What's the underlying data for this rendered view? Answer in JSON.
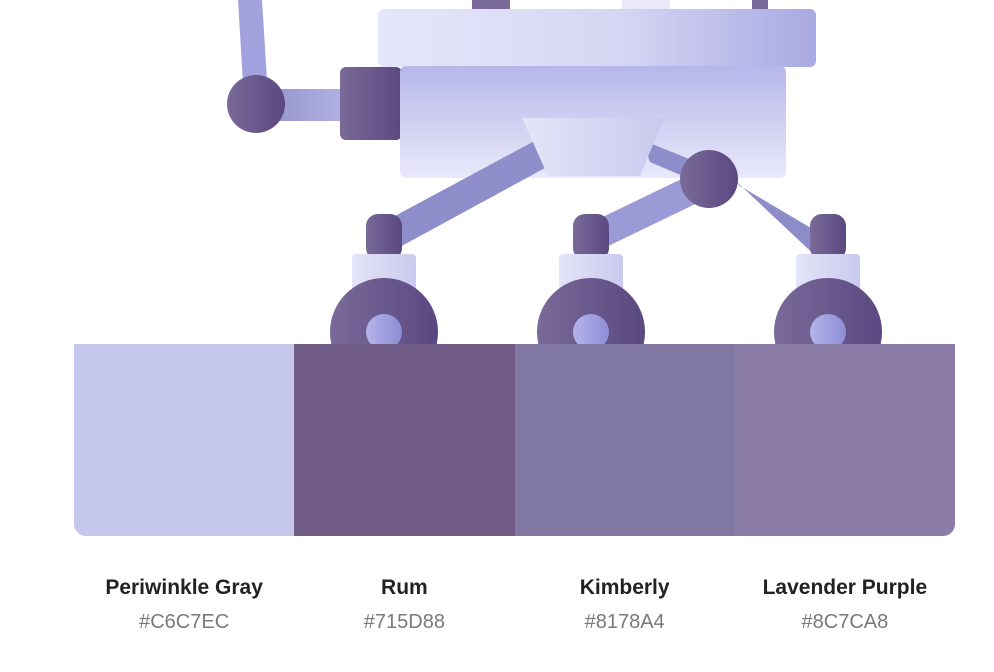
{
  "palette": {
    "colors": [
      {
        "name": "Periwinkle Gray",
        "hex": "#C6C7EC"
      },
      {
        "name": "Rum",
        "hex": "#715D88"
      },
      {
        "name": "Kimberly",
        "hex": "#8178A4"
      },
      {
        "name": "Lavender Purple",
        "hex": "#8C7CA8"
      }
    ]
  }
}
